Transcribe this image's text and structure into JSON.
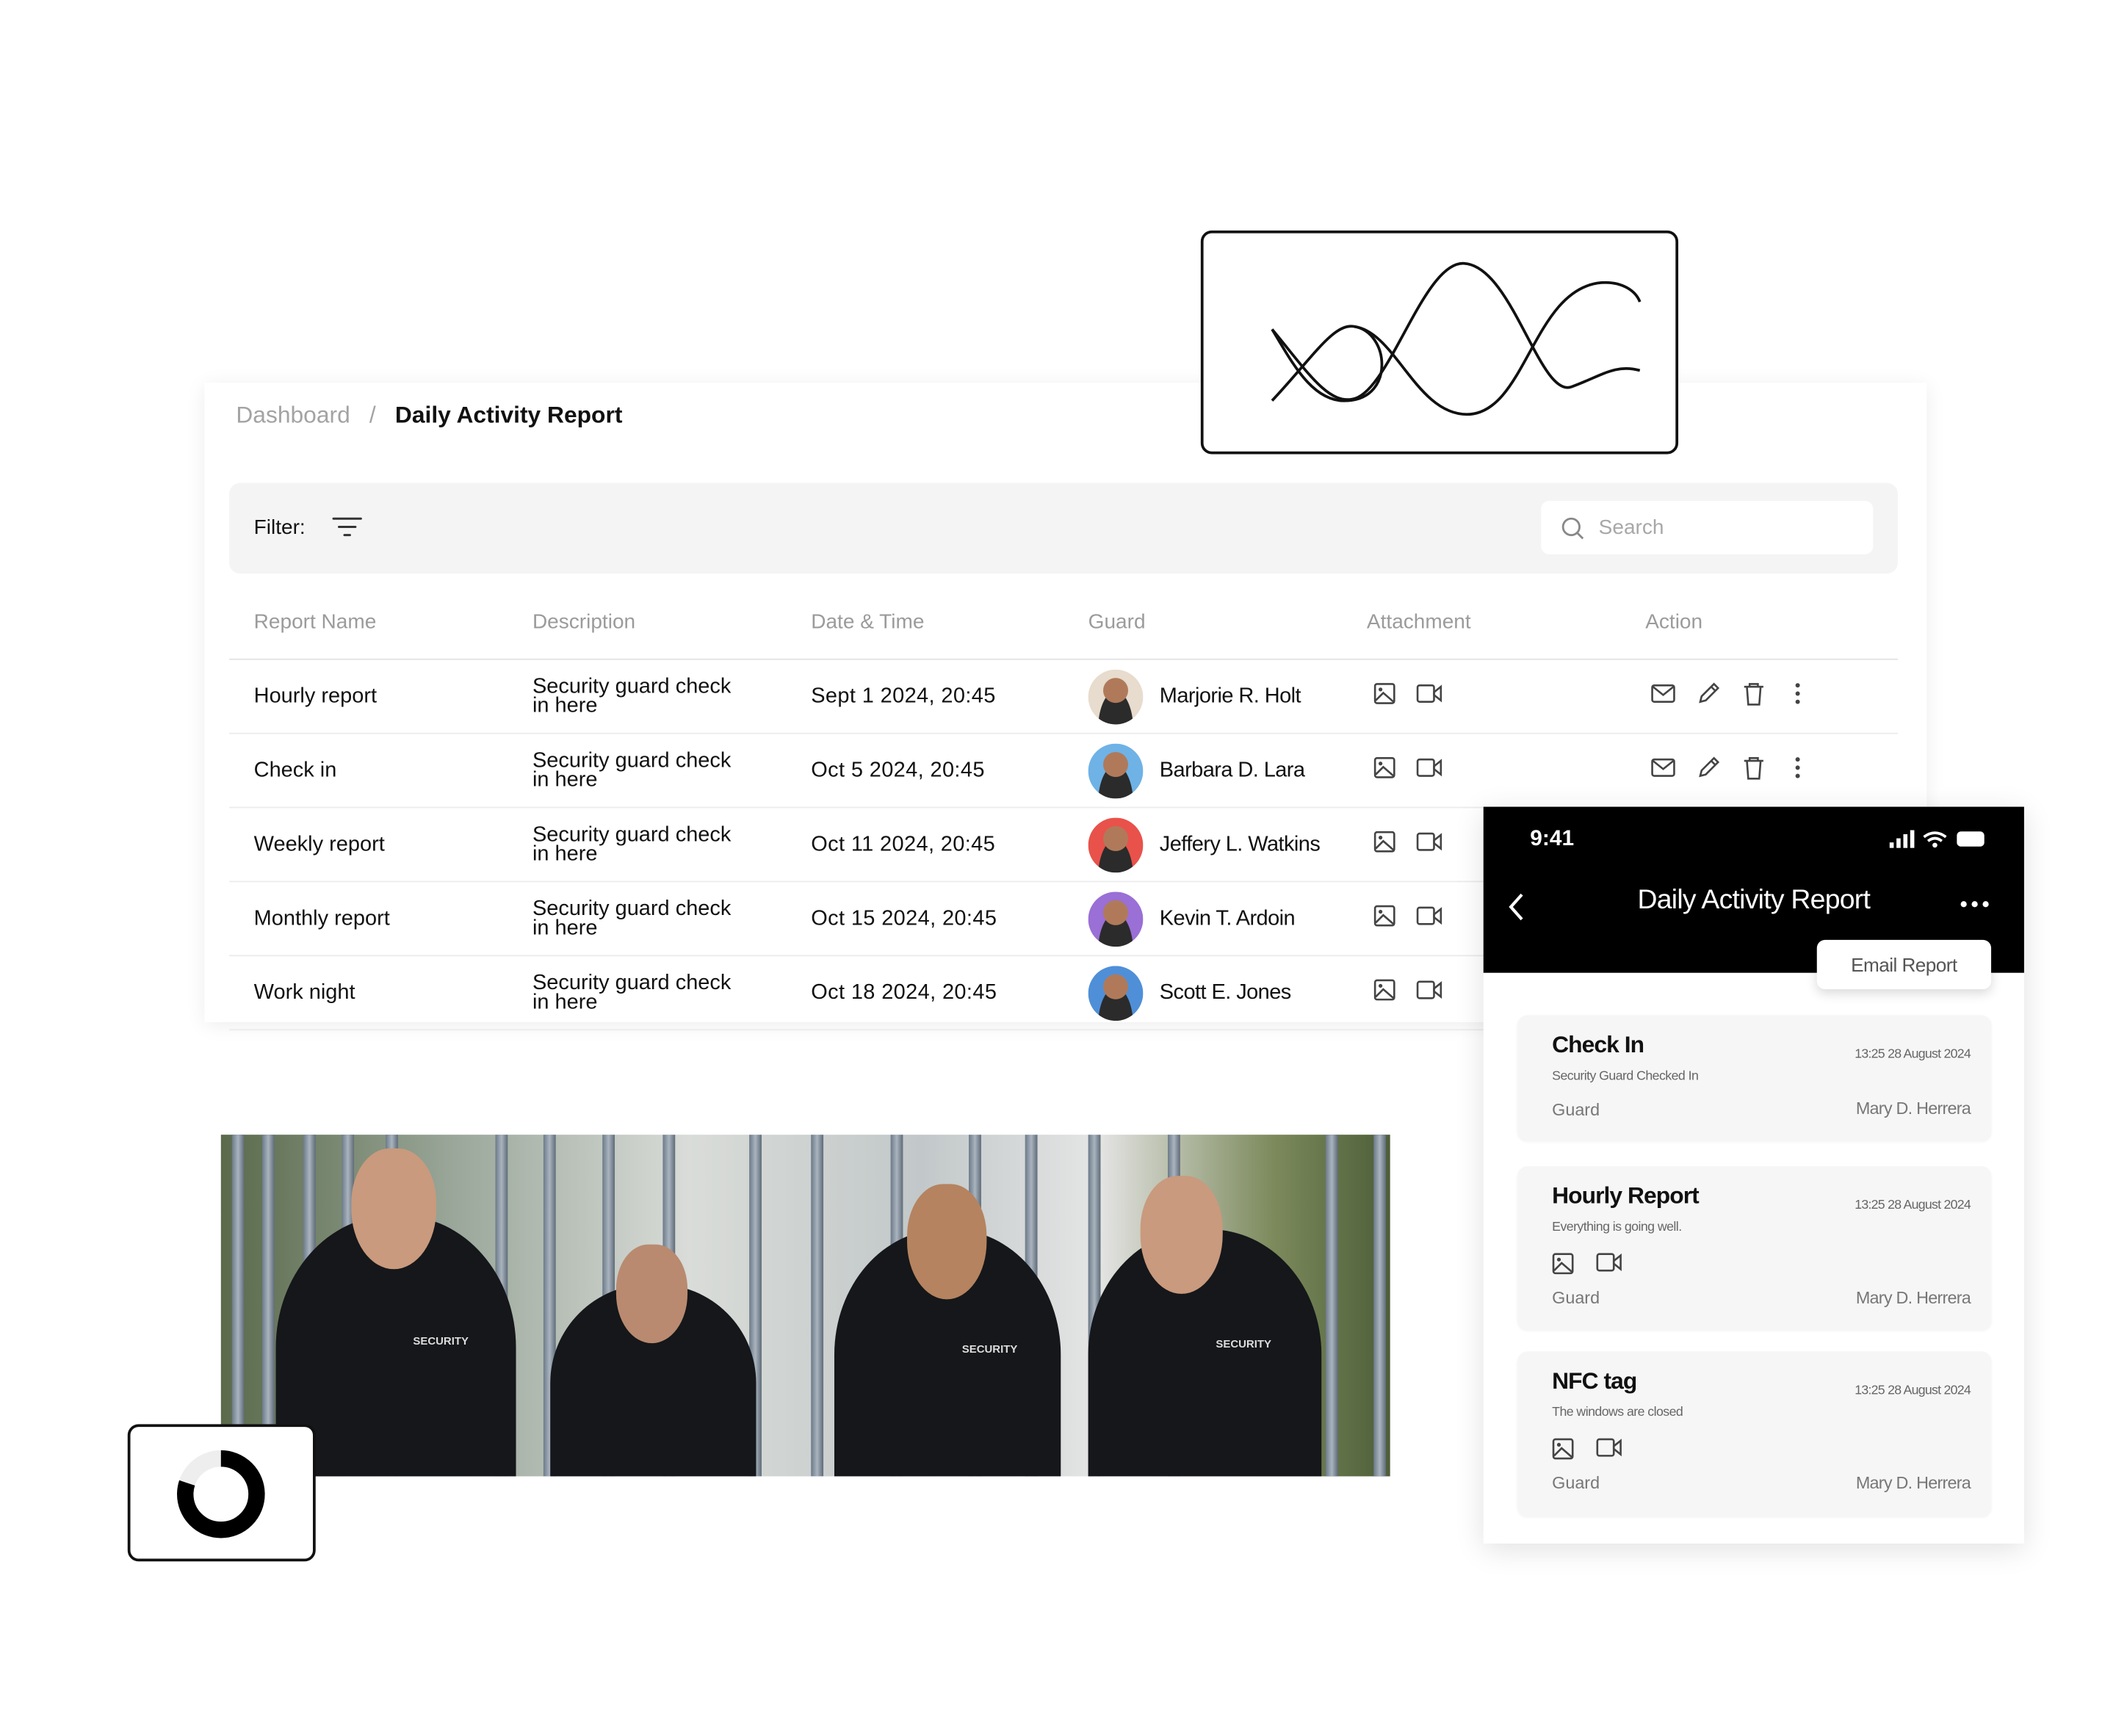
{
  "breadcrumb": {
    "parent": "Dashboard",
    "separator": "/",
    "current": "Daily Activity Report"
  },
  "filter": {
    "label": "Filter:",
    "icon": "filter-icon"
  },
  "search": {
    "placeholder": "Search",
    "icon": "search-icon"
  },
  "table": {
    "columns": [
      "Report Name",
      "Description",
      "Date & Time",
      "Guard",
      "Attachment",
      "Action"
    ],
    "rows": [
      {
        "name": "Hourly report",
        "desc1": "Security guard check",
        "desc2": "in here",
        "datetime": "Sept 1 2024, 20:45",
        "guard": "Marjorie R. Holt",
        "avatar_color": "#e7dccd",
        "actions": true
      },
      {
        "name": "Check in",
        "desc1": "Security guard check",
        "desc2": "in here",
        "datetime": "Oct 5 2024, 20:45",
        "guard": "Barbara D. Lara",
        "avatar_color": "#6fb2e6",
        "actions": true
      },
      {
        "name": "Weekly report",
        "desc1": "Security guard check",
        "desc2": "in here",
        "datetime": "Oct 11 2024, 20:45",
        "guard": "Jeffery L. Watkins",
        "avatar_color": "#e8524a",
        "actions": false
      },
      {
        "name": "Monthly report",
        "desc1": "Security guard check",
        "desc2": "in here",
        "datetime": "Oct 15 2024, 20:45",
        "guard": "Kevin T. Ardoin",
        "avatar_color": "#9a6fd6",
        "actions": false
      },
      {
        "name": "Work night",
        "desc1": "Security guard check",
        "desc2": "in here",
        "datetime": "Oct 18 2024, 20:45",
        "guard": "Scott E. Jones",
        "avatar_color": "#4f8fd8",
        "actions": false
      }
    ]
  },
  "photo": {
    "jacket_text": "SECURITY"
  },
  "phone": {
    "time": "9:41",
    "title": "Daily Activity Report",
    "email_button": "Email Report",
    "cards": [
      {
        "title": "Check In",
        "date": "13:25 28 August 2024",
        "subtitle": "Security Guard Checked In",
        "guard_label": "Guard",
        "guard_name": "Mary D. Herrera",
        "attachments": false
      },
      {
        "title": "Hourly Report",
        "date": "13:25 28 August 2024",
        "subtitle": "Everything is going well.",
        "guard_label": "Guard",
        "guard_name": "Mary D. Herrera",
        "attachments": true
      },
      {
        "title": "NFC tag",
        "date": "13:25 28 August 2024",
        "subtitle": "The windows are closed",
        "guard_label": "Guard",
        "guard_name": "Mary D. Herrera",
        "attachments": true
      }
    ]
  },
  "donut": {
    "value_percent": 80
  }
}
